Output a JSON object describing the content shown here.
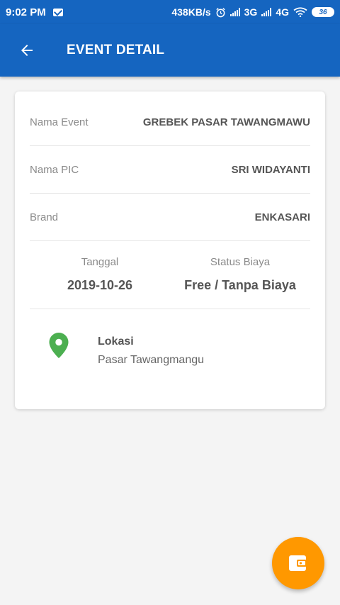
{
  "status_bar": {
    "time": "9:02 PM",
    "net_speed": "438KB/s",
    "net_3g": "3G",
    "net_4g": "4G",
    "battery": "36"
  },
  "app_bar": {
    "title": "EVENT DETAIL",
    "back_icon": "arrow-back-icon"
  },
  "details": {
    "event_label": "Nama Event",
    "event_value": "GREBEK PASAR TAWANGMAWU",
    "pic_label": "Nama PIC",
    "pic_value": "SRI WIDAYANTI",
    "brand_label": "Brand",
    "brand_value": "ENKASARI",
    "date_label": "Tanggal",
    "date_value": "2019-10-26",
    "cost_label": "Status Biaya",
    "cost_value": "Free / Tanpa Biaya",
    "location_label": "Lokasi",
    "location_value": "Pasar Tawangmangu"
  },
  "colors": {
    "primary": "#1565c0",
    "fab": "#ff9800",
    "pin": "#4caf50"
  },
  "fab": {
    "icon": "wallet-icon"
  }
}
